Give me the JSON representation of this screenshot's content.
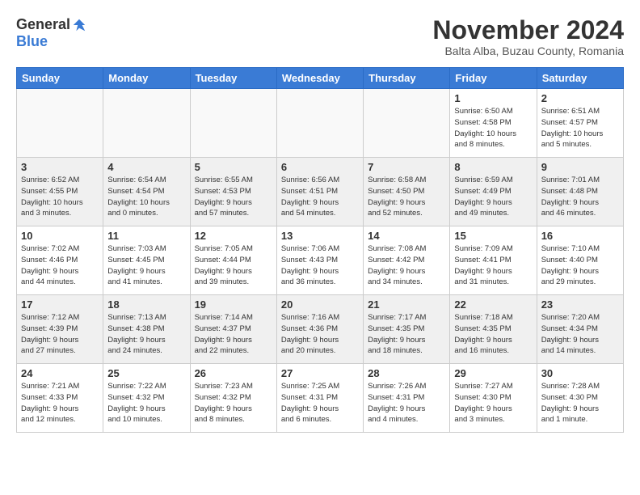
{
  "logo": {
    "general": "General",
    "blue": "Blue"
  },
  "title": "November 2024",
  "subtitle": "Balta Alba, Buzau County, Romania",
  "days_of_week": [
    "Sunday",
    "Monday",
    "Tuesday",
    "Wednesday",
    "Thursday",
    "Friday",
    "Saturday"
  ],
  "weeks": [
    {
      "cells": [
        {
          "day": "",
          "info": ""
        },
        {
          "day": "",
          "info": ""
        },
        {
          "day": "",
          "info": ""
        },
        {
          "day": "",
          "info": ""
        },
        {
          "day": "",
          "info": ""
        },
        {
          "day": "1",
          "info": "Sunrise: 6:50 AM\nSunset: 4:58 PM\nDaylight: 10 hours\nand 8 minutes."
        },
        {
          "day": "2",
          "info": "Sunrise: 6:51 AM\nSunset: 4:57 PM\nDaylight: 10 hours\nand 5 minutes."
        }
      ]
    },
    {
      "cells": [
        {
          "day": "3",
          "info": "Sunrise: 6:52 AM\nSunset: 4:55 PM\nDaylight: 10 hours\nand 3 minutes."
        },
        {
          "day": "4",
          "info": "Sunrise: 6:54 AM\nSunset: 4:54 PM\nDaylight: 10 hours\nand 0 minutes."
        },
        {
          "day": "5",
          "info": "Sunrise: 6:55 AM\nSunset: 4:53 PM\nDaylight: 9 hours\nand 57 minutes."
        },
        {
          "day": "6",
          "info": "Sunrise: 6:56 AM\nSunset: 4:51 PM\nDaylight: 9 hours\nand 54 minutes."
        },
        {
          "day": "7",
          "info": "Sunrise: 6:58 AM\nSunset: 4:50 PM\nDaylight: 9 hours\nand 52 minutes."
        },
        {
          "day": "8",
          "info": "Sunrise: 6:59 AM\nSunset: 4:49 PM\nDaylight: 9 hours\nand 49 minutes."
        },
        {
          "day": "9",
          "info": "Sunrise: 7:01 AM\nSunset: 4:48 PM\nDaylight: 9 hours\nand 46 minutes."
        }
      ]
    },
    {
      "cells": [
        {
          "day": "10",
          "info": "Sunrise: 7:02 AM\nSunset: 4:46 PM\nDaylight: 9 hours\nand 44 minutes."
        },
        {
          "day": "11",
          "info": "Sunrise: 7:03 AM\nSunset: 4:45 PM\nDaylight: 9 hours\nand 41 minutes."
        },
        {
          "day": "12",
          "info": "Sunrise: 7:05 AM\nSunset: 4:44 PM\nDaylight: 9 hours\nand 39 minutes."
        },
        {
          "day": "13",
          "info": "Sunrise: 7:06 AM\nSunset: 4:43 PM\nDaylight: 9 hours\nand 36 minutes."
        },
        {
          "day": "14",
          "info": "Sunrise: 7:08 AM\nSunset: 4:42 PM\nDaylight: 9 hours\nand 34 minutes."
        },
        {
          "day": "15",
          "info": "Sunrise: 7:09 AM\nSunset: 4:41 PM\nDaylight: 9 hours\nand 31 minutes."
        },
        {
          "day": "16",
          "info": "Sunrise: 7:10 AM\nSunset: 4:40 PM\nDaylight: 9 hours\nand 29 minutes."
        }
      ]
    },
    {
      "cells": [
        {
          "day": "17",
          "info": "Sunrise: 7:12 AM\nSunset: 4:39 PM\nDaylight: 9 hours\nand 27 minutes."
        },
        {
          "day": "18",
          "info": "Sunrise: 7:13 AM\nSunset: 4:38 PM\nDaylight: 9 hours\nand 24 minutes."
        },
        {
          "day": "19",
          "info": "Sunrise: 7:14 AM\nSunset: 4:37 PM\nDaylight: 9 hours\nand 22 minutes."
        },
        {
          "day": "20",
          "info": "Sunrise: 7:16 AM\nSunset: 4:36 PM\nDaylight: 9 hours\nand 20 minutes."
        },
        {
          "day": "21",
          "info": "Sunrise: 7:17 AM\nSunset: 4:35 PM\nDaylight: 9 hours\nand 18 minutes."
        },
        {
          "day": "22",
          "info": "Sunrise: 7:18 AM\nSunset: 4:35 PM\nDaylight: 9 hours\nand 16 minutes."
        },
        {
          "day": "23",
          "info": "Sunrise: 7:20 AM\nSunset: 4:34 PM\nDaylight: 9 hours\nand 14 minutes."
        }
      ]
    },
    {
      "cells": [
        {
          "day": "24",
          "info": "Sunrise: 7:21 AM\nSunset: 4:33 PM\nDaylight: 9 hours\nand 12 minutes."
        },
        {
          "day": "25",
          "info": "Sunrise: 7:22 AM\nSunset: 4:32 PM\nDaylight: 9 hours\nand 10 minutes."
        },
        {
          "day": "26",
          "info": "Sunrise: 7:23 AM\nSunset: 4:32 PM\nDaylight: 9 hours\nand 8 minutes."
        },
        {
          "day": "27",
          "info": "Sunrise: 7:25 AM\nSunset: 4:31 PM\nDaylight: 9 hours\nand 6 minutes."
        },
        {
          "day": "28",
          "info": "Sunrise: 7:26 AM\nSunset: 4:31 PM\nDaylight: 9 hours\nand 4 minutes."
        },
        {
          "day": "29",
          "info": "Sunrise: 7:27 AM\nSunset: 4:30 PM\nDaylight: 9 hours\nand 3 minutes."
        },
        {
          "day": "30",
          "info": "Sunrise: 7:28 AM\nSunset: 4:30 PM\nDaylight: 9 hours\nand 1 minute."
        }
      ]
    }
  ]
}
